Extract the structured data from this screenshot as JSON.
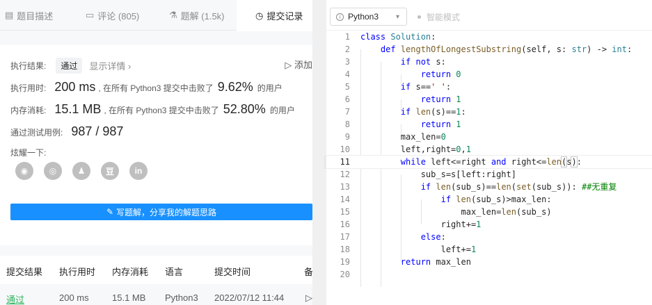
{
  "tabs": [
    {
      "label": "题目描述",
      "icon": "document-icon"
    },
    {
      "label": "评论 (805)",
      "icon": "comment-icon"
    },
    {
      "label": "题解 (1.5k)",
      "icon": "flask-icon"
    },
    {
      "label": "提交记录",
      "icon": "clock-icon",
      "active": true
    }
  ],
  "result": {
    "result_label": "执行结果:",
    "result_value": "通过",
    "detail_link": "显示详情 ›",
    "add_label": "添加",
    "time_label": "执行用时:",
    "time_value": "200 ms",
    "time_text": ", 在所有 Python3 提交中击败了",
    "time_pct": "9.62%",
    "time_suffix": "的用户",
    "mem_label": "内存消耗:",
    "mem_value": "15.1 MB",
    "mem_text": ", 在所有 Python3 提交中击败了",
    "mem_pct": "52.80%",
    "mem_suffix": "的用户",
    "tests_label": "通过测试用例:",
    "tests_value": "987 / 987",
    "share_label": "炫耀一下:",
    "share_icons": [
      {
        "name": "wechat-icon",
        "glyph": "◉"
      },
      {
        "name": "weibo-icon",
        "glyph": "◎"
      },
      {
        "name": "qq-icon",
        "glyph": "♟"
      },
      {
        "name": "douban-icon",
        "glyph": "豆"
      },
      {
        "name": "linkedin-icon",
        "glyph": "in"
      }
    ],
    "write_button": "写题解，分享我的解题思路"
  },
  "submissions": {
    "headers": [
      "提交结果",
      "执行用时",
      "内存消耗",
      "语言",
      "提交时间",
      "备"
    ],
    "rows": [
      {
        "result": "通过",
        "time": "200 ms",
        "memory": "15.1 MB",
        "language": "Python3",
        "submitted": "2022/07/12 11:44"
      }
    ]
  },
  "editor": {
    "language": "Python3",
    "smart_mode": "智能模式",
    "current_line": 11
  }
}
